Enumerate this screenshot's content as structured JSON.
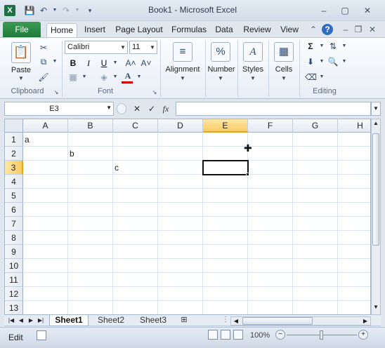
{
  "window": {
    "title": "Book1 - Microsoft Excel",
    "app_icon_label": "X",
    "minimize_label": "–",
    "maximize_label": "▢",
    "close_label": "✕"
  },
  "quick_access": {
    "save_icon": "save-icon",
    "undo_icon": "undo-icon",
    "redo_icon": "redo-icon",
    "customize_icon": "customize-icon"
  },
  "ribbon_tabs": [
    {
      "label": "File"
    },
    {
      "label": "Home"
    },
    {
      "label": "Insert"
    },
    {
      "label": "Page Layout"
    },
    {
      "label": "Formulas"
    },
    {
      "label": "Data"
    },
    {
      "label": "Review"
    },
    {
      "label": "View"
    }
  ],
  "ribbon": {
    "clipboard": {
      "paste_label": "Paste",
      "group_label": "Clipboard"
    },
    "font": {
      "font_name": "Calibri",
      "font_size": "11",
      "bold": "B",
      "italic": "I",
      "underline": "U",
      "group_label": "Font",
      "font_color": "#d00000"
    },
    "alignment": {
      "label": "Alignment"
    },
    "number": {
      "label": "Number"
    },
    "styles": {
      "label": "Styles"
    },
    "cells": {
      "label": "Cells"
    },
    "editing": {
      "group_label": "Editing"
    }
  },
  "formula_bar": {
    "name_box": "E3",
    "fx_label": "fx",
    "cancel_label": "✕",
    "enter_label": "✓",
    "formula_value": ""
  },
  "grid": {
    "columns": [
      "A",
      "B",
      "C",
      "D",
      "E",
      "F",
      "G",
      "H"
    ],
    "rows": [
      "1",
      "2",
      "3",
      "4",
      "5",
      "6",
      "7",
      "8",
      "9",
      "10",
      "11",
      "12",
      "13"
    ],
    "selected_column": "E",
    "selected_row": "3",
    "cells": [
      {
        "ref": "A1",
        "value": "a"
      },
      {
        "ref": "B2",
        "value": "b"
      },
      {
        "ref": "C3",
        "value": "c"
      }
    ]
  },
  "sheets": [
    {
      "label": "Sheet1",
      "active": true
    },
    {
      "label": "Sheet2"
    },
    {
      "label": "Sheet3"
    }
  ],
  "status": {
    "mode": "Edit",
    "zoom": "100%"
  }
}
